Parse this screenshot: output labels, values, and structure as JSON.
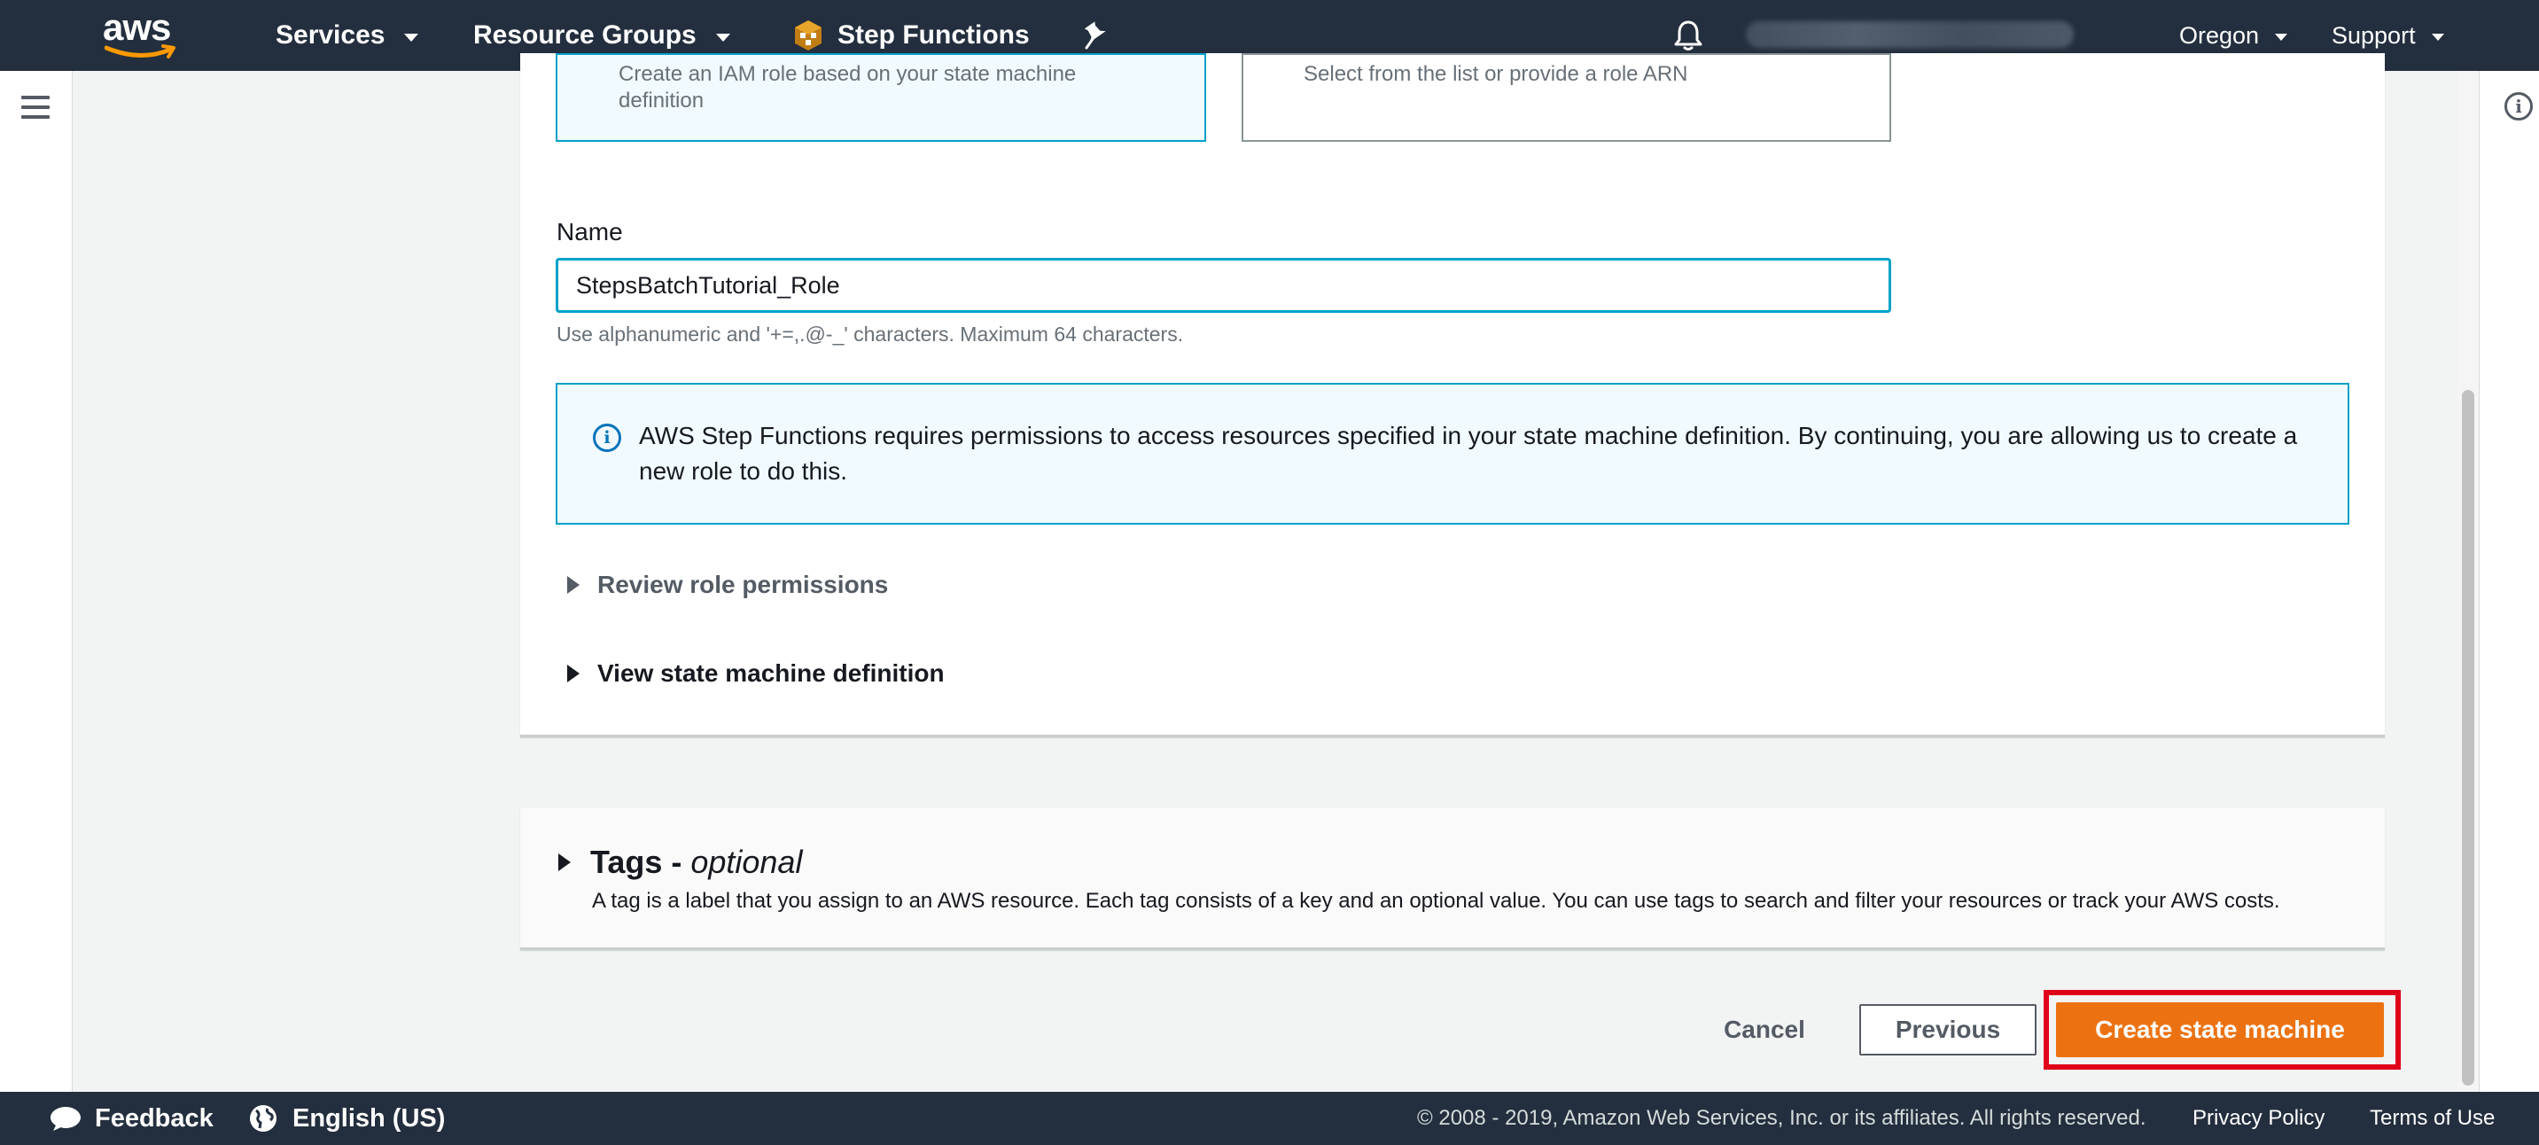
{
  "nav": {
    "logo_text": "aws",
    "services": "Services",
    "resource_groups": "Resource Groups",
    "step_functions": "Step Functions",
    "region": "Oregon",
    "support": "Support"
  },
  "role_tiles": {
    "create_desc": "Create an IAM role based on your state machine definition",
    "existing_desc": "Select from the list or provide a role ARN"
  },
  "name_field": {
    "label": "Name",
    "value": "StepsBatchTutorial_Role",
    "hint": "Use alphanumeric and '+=,.@-_' characters. Maximum 64 characters."
  },
  "info_alert": {
    "message": "AWS Step Functions requires permissions to access resources specified in your state machine definition. By continuing, you are allowing us to create a new role to do this."
  },
  "expanders": {
    "review_permissions": "Review role permissions",
    "view_definition": "View state machine definition"
  },
  "tags": {
    "title": "Tags -",
    "optional": "optional",
    "description": "A tag is a label that you assign to an AWS resource. Each tag consists of a key and an optional value. You can use tags to search and filter your resources or track your AWS costs."
  },
  "actions": {
    "cancel": "Cancel",
    "previous": "Previous",
    "create": "Create state machine"
  },
  "footer": {
    "feedback": "Feedback",
    "language": "English (US)",
    "copyright": "© 2008 - 2019, Amazon Web Services, Inc. or its affiliates. All rights reserved.",
    "privacy": "Privacy Policy",
    "terms": "Terms of Use"
  },
  "colors": {
    "nav_bg": "#232f3e",
    "primary_button": "#ec7211",
    "accent_info": "#00a1c9",
    "highlight_outline": "#e0001a"
  },
  "icons": [
    "aws-logo",
    "chevron-down-icon",
    "step-functions-icon",
    "pin-icon",
    "bell-icon",
    "hamburger-menu-icon",
    "info-icon",
    "caret-right-icon",
    "speech-bubble-icon",
    "globe-icon"
  ]
}
